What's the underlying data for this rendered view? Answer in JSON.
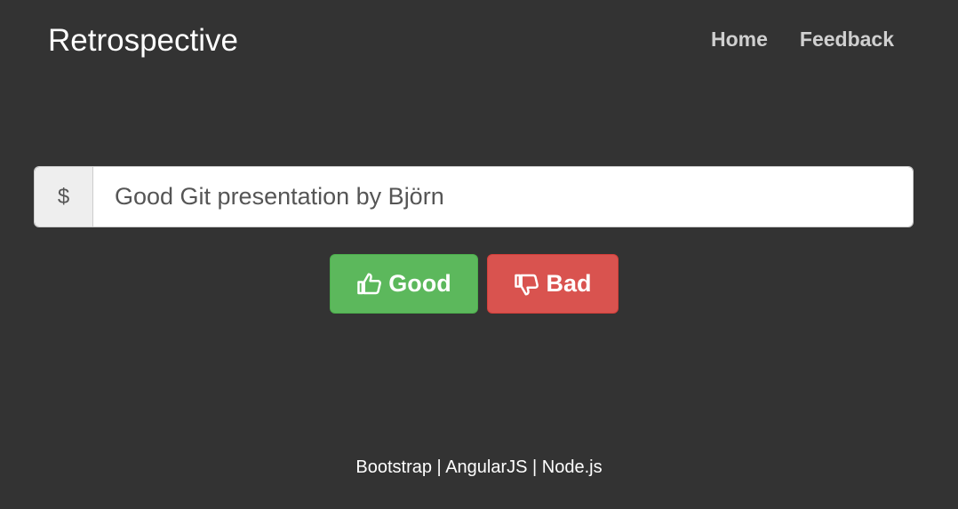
{
  "header": {
    "brand": "Retrospective",
    "nav": [
      {
        "label": "Home"
      },
      {
        "label": "Feedback"
      }
    ]
  },
  "input": {
    "addon": "$",
    "value": "Good Git presentation by Björn"
  },
  "actions": {
    "good_label": "Good",
    "good_icon": "thumbs-up-icon",
    "bad_label": "Bad",
    "bad_icon": "thumbs-down-icon"
  },
  "footer": {
    "text": "Bootstrap | AngularJS | Node.js"
  },
  "colors": {
    "background": "#333333",
    "good": "#5cb85c",
    "bad": "#d9534f"
  }
}
